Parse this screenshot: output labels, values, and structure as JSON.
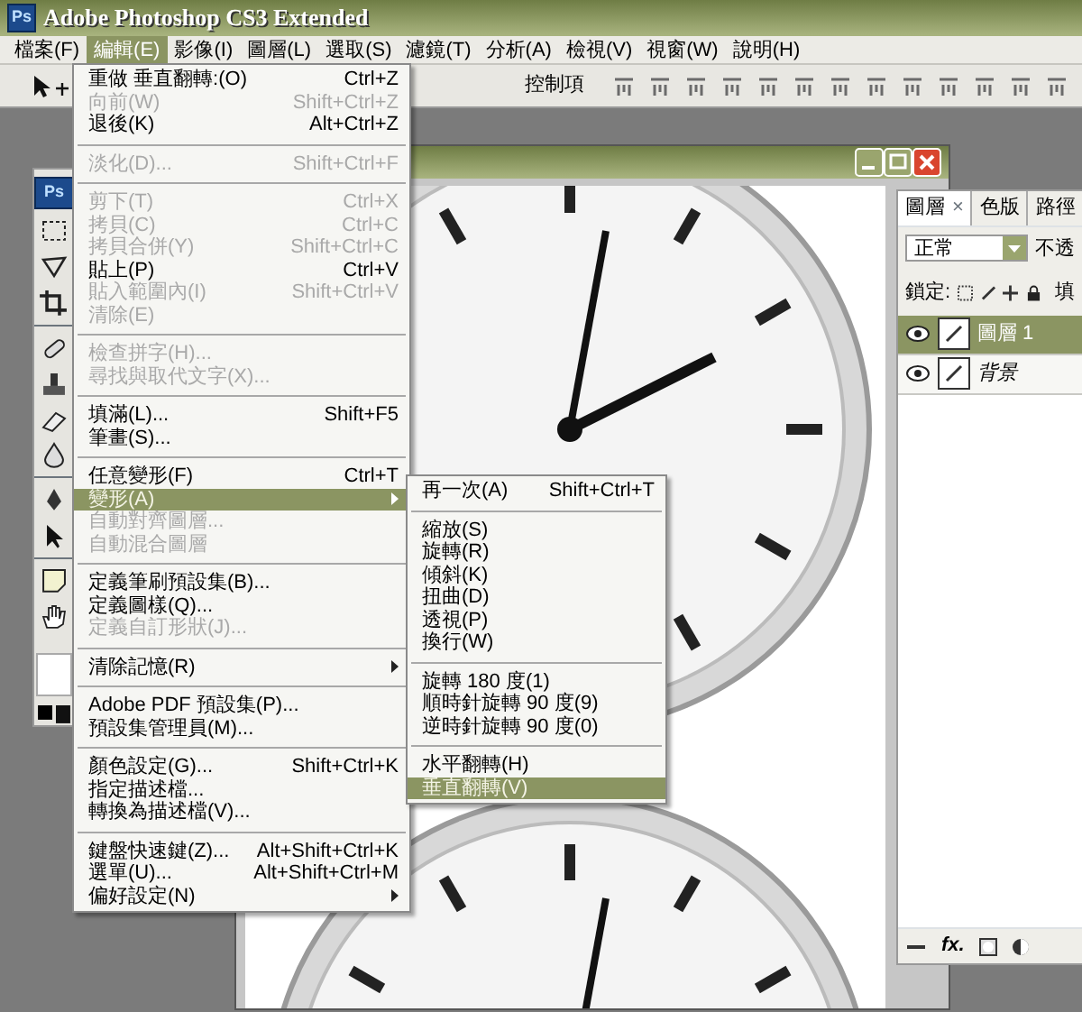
{
  "window": {
    "title": "Adobe Photoshop CS3 Extended",
    "logo": "Ps"
  },
  "menu_bar": [
    {
      "label": "檔案(F)",
      "selected": false
    },
    {
      "label": "編輯(E)",
      "selected": true
    },
    {
      "label": "影像(I)",
      "selected": false
    },
    {
      "label": "圖層(L)",
      "selected": false
    },
    {
      "label": "選取(S)",
      "selected": false
    },
    {
      "label": "濾鏡(T)",
      "selected": false
    },
    {
      "label": "分析(A)",
      "selected": false
    },
    {
      "label": "檢視(V)",
      "selected": false
    },
    {
      "label": "視窗(W)",
      "selected": false
    },
    {
      "label": "說明(H)",
      "selected": false
    }
  ],
  "options_bar": {
    "label": "控制項"
  },
  "toolbox": {
    "logo": "Ps"
  },
  "edit_menu": {
    "sections": [
      {
        "items": [
          {
            "label": "重做 垂直翻轉:(O)",
            "shortcut": "Ctrl+Z",
            "disabled": false,
            "selected": false
          },
          {
            "label": "向前(W)",
            "shortcut": "Shift+Ctrl+Z",
            "disabled": true,
            "selected": false
          },
          {
            "label": "退後(K)",
            "shortcut": "Alt+Ctrl+Z",
            "disabled": false,
            "selected": false
          }
        ]
      },
      {
        "items": [
          {
            "label": "淡化(D)...",
            "shortcut": "Shift+Ctrl+F",
            "disabled": true,
            "selected": false
          }
        ]
      },
      {
        "items": [
          {
            "label": "剪下(T)",
            "shortcut": "Ctrl+X",
            "disabled": true,
            "selected": false
          },
          {
            "label": "拷貝(C)",
            "shortcut": "Ctrl+C",
            "disabled": true,
            "selected": false
          },
          {
            "label": "拷貝合併(Y)",
            "shortcut": "Shift+Ctrl+C",
            "disabled": true,
            "selected": false
          },
          {
            "label": "貼上(P)",
            "shortcut": "Ctrl+V",
            "disabled": false,
            "selected": false
          },
          {
            "label": "貼入範圍內(I)",
            "shortcut": "Shift+Ctrl+V",
            "disabled": true,
            "selected": false
          },
          {
            "label": "清除(E)",
            "disabled": true,
            "selected": false
          }
        ]
      },
      {
        "items": [
          {
            "label": "檢查拼字(H)...",
            "disabled": true,
            "selected": false
          },
          {
            "label": "尋找與取代文字(X)...",
            "disabled": true,
            "selected": false
          }
        ]
      },
      {
        "items": [
          {
            "label": "填滿(L)...",
            "shortcut": "Shift+F5",
            "disabled": false,
            "selected": false
          },
          {
            "label": "筆畫(S)...",
            "disabled": false,
            "selected": false
          }
        ]
      },
      {
        "items": [
          {
            "label": "任意變形(F)",
            "shortcut": "Ctrl+T",
            "disabled": false,
            "selected": false
          },
          {
            "label": "變形(A)",
            "disabled": false,
            "selected": true,
            "submenu": true
          },
          {
            "label": "自動對齊圖層...",
            "disabled": true,
            "selected": false
          },
          {
            "label": "自動混合圖層",
            "disabled": true,
            "selected": false
          }
        ]
      },
      {
        "items": [
          {
            "label": "定義筆刷預設集(B)...",
            "disabled": false,
            "selected": false
          },
          {
            "label": "定義圖樣(Q)...",
            "disabled": false,
            "selected": false
          },
          {
            "label": "定義自訂形狀(J)...",
            "disabled": true,
            "selected": false
          }
        ]
      },
      {
        "items": [
          {
            "label": "清除記憶(R)",
            "disabled": false,
            "selected": false,
            "submenu": true
          }
        ]
      },
      {
        "items": [
          {
            "label": "Adobe PDF 預設集(P)...",
            "disabled": false,
            "selected": false
          },
          {
            "label": "預設集管理員(M)...",
            "disabled": false,
            "selected": false
          }
        ]
      },
      {
        "items": [
          {
            "label": "顏色設定(G)...",
            "shortcut": "Shift+Ctrl+K",
            "disabled": false,
            "selected": false
          },
          {
            "label": "指定描述檔...",
            "disabled": false,
            "selected": false
          },
          {
            "label": "轉換為描述檔(V)...",
            "disabled": false,
            "selected": false
          }
        ]
      },
      {
        "items": [
          {
            "label": "鍵盤快速鍵(Z)...",
            "shortcut": "Alt+Shift+Ctrl+K",
            "disabled": false,
            "selected": false
          },
          {
            "label": "選單(U)...",
            "shortcut": "Alt+Shift+Ctrl+M",
            "disabled": false,
            "selected": false
          },
          {
            "label": "偏好設定(N)",
            "disabled": false,
            "selected": false,
            "submenu": true
          }
        ]
      }
    ]
  },
  "transform_submenu": {
    "sections": [
      {
        "items": [
          {
            "label": "再一次(A)",
            "shortcut": "Shift+Ctrl+T",
            "disabled": false,
            "selected": false
          }
        ]
      },
      {
        "items": [
          {
            "label": "縮放(S)",
            "disabled": false,
            "selected": false
          },
          {
            "label": "旋轉(R)",
            "disabled": false,
            "selected": false
          },
          {
            "label": "傾斜(K)",
            "disabled": false,
            "selected": false
          },
          {
            "label": "扭曲(D)",
            "disabled": false,
            "selected": false
          },
          {
            "label": "透視(P)",
            "disabled": false,
            "selected": false
          },
          {
            "label": "換行(W)",
            "disabled": false,
            "selected": false
          }
        ]
      },
      {
        "items": [
          {
            "label": "旋轉 180 度(1)",
            "disabled": false,
            "selected": false
          },
          {
            "label": "順時針旋轉 90 度(9)",
            "disabled": false,
            "selected": false
          },
          {
            "label": "逆時針旋轉 90 度(0)",
            "disabled": false,
            "selected": false
          }
        ]
      },
      {
        "items": [
          {
            "label": "水平翻轉(H)",
            "disabled": false,
            "selected": false
          },
          {
            "label": "垂直翻轉(V)",
            "disabled": false,
            "selected": true
          }
        ]
      }
    ]
  },
  "layers_panel": {
    "tabs": [
      {
        "label": "圖層",
        "close": "×",
        "selected": true
      },
      {
        "label": "色版",
        "selected": false
      },
      {
        "label": "路徑",
        "selected": false
      }
    ],
    "blend_mode": "正常",
    "opacity_label": "不透",
    "lock_label": "鎖定:",
    "fill_label": "填",
    "layers": [
      {
        "name": "圖層 1",
        "kind": "layer",
        "selected": true
      },
      {
        "name": "背景",
        "kind": "background",
        "selected": false
      }
    ],
    "fx_label": "fx."
  }
}
